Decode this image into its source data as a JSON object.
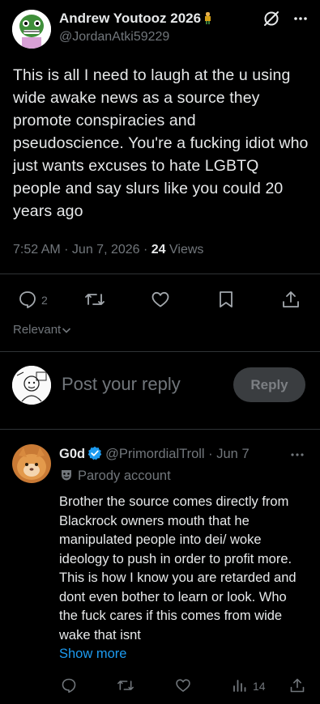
{
  "tweet": {
    "author_name": "Andrew Youtooz 2026",
    "author_handle": "@JordanAtki59229",
    "text": "This is all I need to laugh at the u using wide awake news as a source they promote conspiracies and pseudoscience. You're a fucking idiot who just wants excuses to hate LGBTQ people and say slurs like you could 20 years ago",
    "time": "7:52 AM · Jun 7, 2026 · ",
    "views_count": "24",
    "views_label": " Views",
    "reply_count": "2",
    "sort_label": "Relevant"
  },
  "composer": {
    "placeholder": "Post your reply",
    "button_label": "Reply"
  },
  "reply": {
    "author_name": "G0d",
    "author_handle": "@PrimordialTroll",
    "time": " · Jun 7",
    "parody_label": "Parody account",
    "text": "Brother the source comes directly from Blackrock owners mouth that he manipulated people into dei/ woke ideology to push in order to profit more. This is how I know you are retarded and dont even bother to learn or look. Who the fuck cares if this comes from wide wake that isnt",
    "show_more": "Show more",
    "views_count": "14"
  },
  "colors": {
    "background": "#000000",
    "text": "#e7e9ea",
    "secondary": "#71767b",
    "link": "#1d9bf0",
    "verified": "#1d9bf0"
  },
  "icons": [
    "grok-icon",
    "more-icon",
    "reply-icon",
    "retweet-icon",
    "like-icon",
    "bookmark-icon",
    "share-icon",
    "chevron-down-icon",
    "verified-icon",
    "parody-mask-icon",
    "views-icon"
  ]
}
